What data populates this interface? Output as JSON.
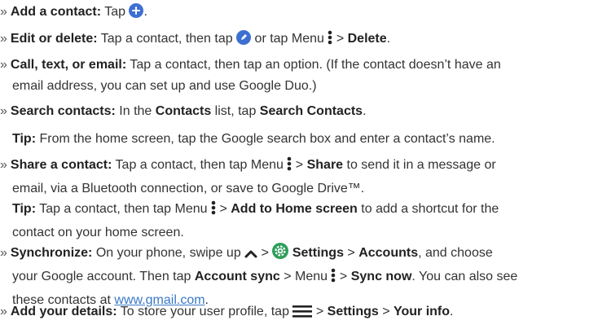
{
  "items": [
    {
      "label": "Add a contact:",
      "text1": " Tap ",
      "text2": "."
    },
    {
      "label": "Edit or delete:",
      "text1": " Tap a contact, then tap ",
      "text2": " or tap Menu ",
      "text3": " > ",
      "bold1": "Delete",
      "text4": "."
    },
    {
      "label": "Call, text, or email:",
      "line1": " Tap a contact, then tap an option. (If the contact doesn’t have an",
      "line2": "email address, you can set up and use Google Duo.)"
    },
    {
      "label": "Search contacts:",
      "text1": " In the ",
      "bold1": "Contacts",
      "text2": " list, tap ",
      "bold2": "Search Contacts",
      "text3": "."
    },
    {
      "tip_label": "Tip:",
      "tip_text": " From the home screen, tap the Google search box and enter a contact’s name."
    },
    {
      "label": "Share a contact:",
      "text1": " Tap a contact, then tap Menu ",
      "text2": " > ",
      "bold1": "Share",
      "text3": " to send it in a message or",
      "line2": "email, via a Bluetooth connection, or save to Google Drive™."
    },
    {
      "tip_label": "Tip:",
      "text1": " Tap a contact, then tap Menu ",
      "text2": " > ",
      "bold1": "Add to Home screen",
      "text3": " to add a shortcut for the",
      "line2": "contact on your home screen."
    },
    {
      "label": "Synchronize:",
      "text1": " On your phone, swipe up ",
      "text2": " > ",
      "bold1": "Settings",
      "text3": " > ",
      "bold2": "Accounts",
      "text4": ", and choose",
      "line2a": "your Google account. Then tap ",
      "bold3": "Account sync",
      "line2b": " > Menu ",
      "line2c": " > ",
      "bold4": "Sync now",
      "line2d": ". You can also see",
      "line3a": "these contacts at ",
      "link": "www.gmail.com",
      "line3b": "."
    },
    {
      "label": "Add your details:",
      "text1": " To store your user profile, tap ",
      "text2": " > ",
      "bold1": "Settings",
      "text3": " > ",
      "bold2": "Your info",
      "text4": "."
    }
  ],
  "bullet": "»",
  "colors": {
    "accent": "#3d6fd3",
    "link": "#3a79c6",
    "text": "#333333"
  },
  "icons": [
    "add-icon",
    "edit-pencil-icon",
    "menu-dots-icon",
    "swipe-up-chevron-icon",
    "settings-gear-icon",
    "hamburger-menu-icon"
  ]
}
